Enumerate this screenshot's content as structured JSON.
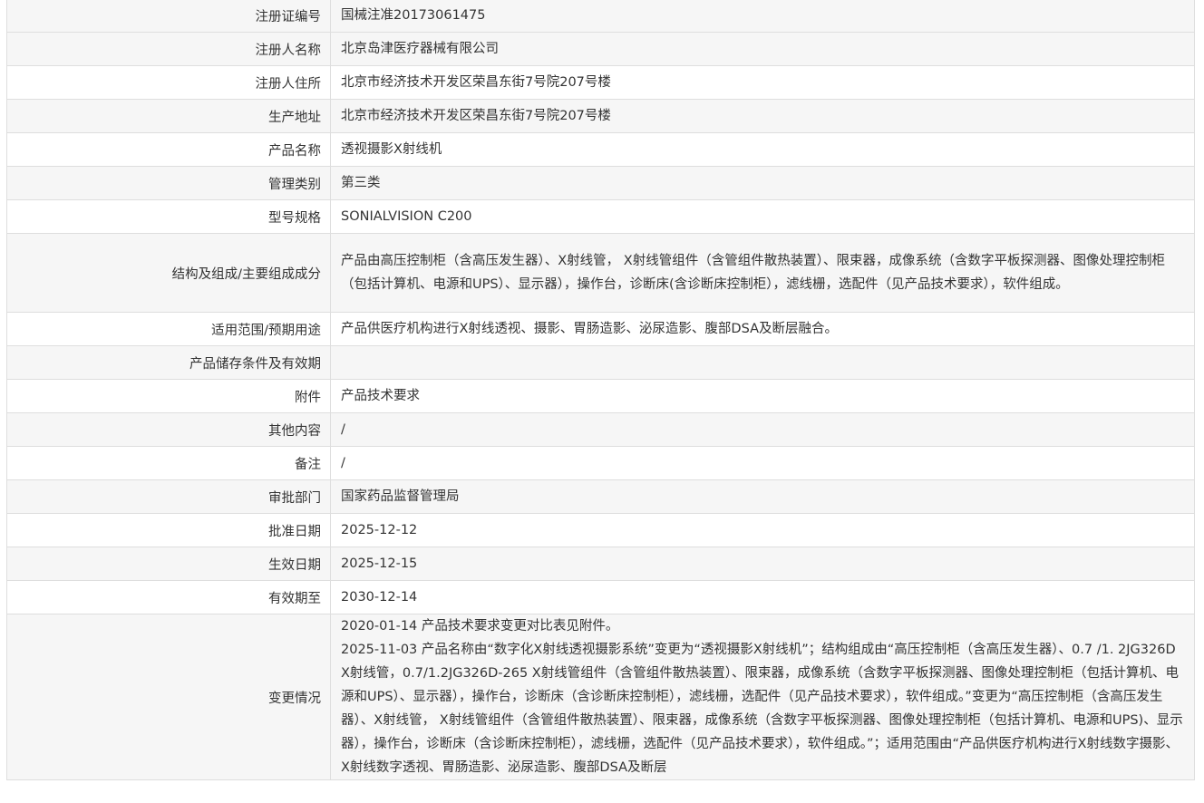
{
  "rows": [
    {
      "label": "注册证编号",
      "value": "国械注准20173061475"
    },
    {
      "label": "注册人名称",
      "value": "北京岛津医疗器械有限公司"
    },
    {
      "label": "注册人住所",
      "value": "北京市经济技术开发区荣昌东街7号院207号楼"
    },
    {
      "label": "生产地址",
      "value": "北京市经济技术开发区荣昌东街7号院207号楼"
    },
    {
      "label": "产品名称",
      "value": "透视摄影X射线机"
    },
    {
      "label": "管理类别",
      "value": "第三类"
    },
    {
      "label": "型号规格",
      "value": "SONIALVISION C200"
    },
    {
      "label": "结构及组成/主要组成成分",
      "value": "产品由高压控制柜（含高压发生器）、X射线管， X射线管组件（含管组件散热装置）、限束器，成像系统（含数字平板探测器、图像处理控制柜（包括计算机、电源和UPS）、显示器），操作台，诊断床(含诊断床控制柜），滤线栅，选配件（见产品技术要求），软件组成。"
    },
    {
      "label": "适用范围/预期用途",
      "value": "产品供医疗机构进行X射线透视、摄影、胃肠造影、泌尿造影、腹部DSA及断层融合。"
    },
    {
      "label": "产品储存条件及有效期",
      "value": ""
    },
    {
      "label": "附件",
      "value": "产品技术要求"
    },
    {
      "label": "其他内容",
      "value": "/"
    },
    {
      "label": "备注",
      "value": "/"
    },
    {
      "label": "审批部门",
      "value": "国家药品监督管理局"
    },
    {
      "label": "批准日期",
      "value": "2025-12-12"
    },
    {
      "label": "生效日期",
      "value": "2025-12-15"
    },
    {
      "label": "有效期至",
      "value": "2030-12-14"
    }
  ],
  "changes": {
    "label": "变更情况",
    "lines": [
      "2020-01-14 产品技术要求变更对比表见附件。",
      "2025-11-03 产品名称由“数字化X射线透视摄影系统”变更为“透视摄影X射线机”；结构组成由“高压控制柜（含高压发生器）、0.7 /1. 2JG326D X射线管，0.7/1.2JG326D-265 X射线管组件（含管组件散热装置）、限束器，成像系统（含数字平板探测器、图像处理控制柜（包括计算机、电源和UPS）、显示器），操作台，诊断床（含诊断床控制柜），滤线栅，选配件（见产品技术要求），软件组成。”变更为“高压控制柜（含高压发生器）、X射线管， X射线管组件（含管组件散热装置）、限束器，成像系统（含数字平板探测器、图像处理控制柜（包括计算机、电源和UPS)、显示器），操作台，诊断床（含诊断床控制柜），滤线栅，选配件（见产品技术要求），软件组成。”；适用范围由“产品供医疗机构进行X射线数字摄影、X射线数字透视、胃肠造影、泌尿造影、腹部DSA及断层"
    ]
  }
}
